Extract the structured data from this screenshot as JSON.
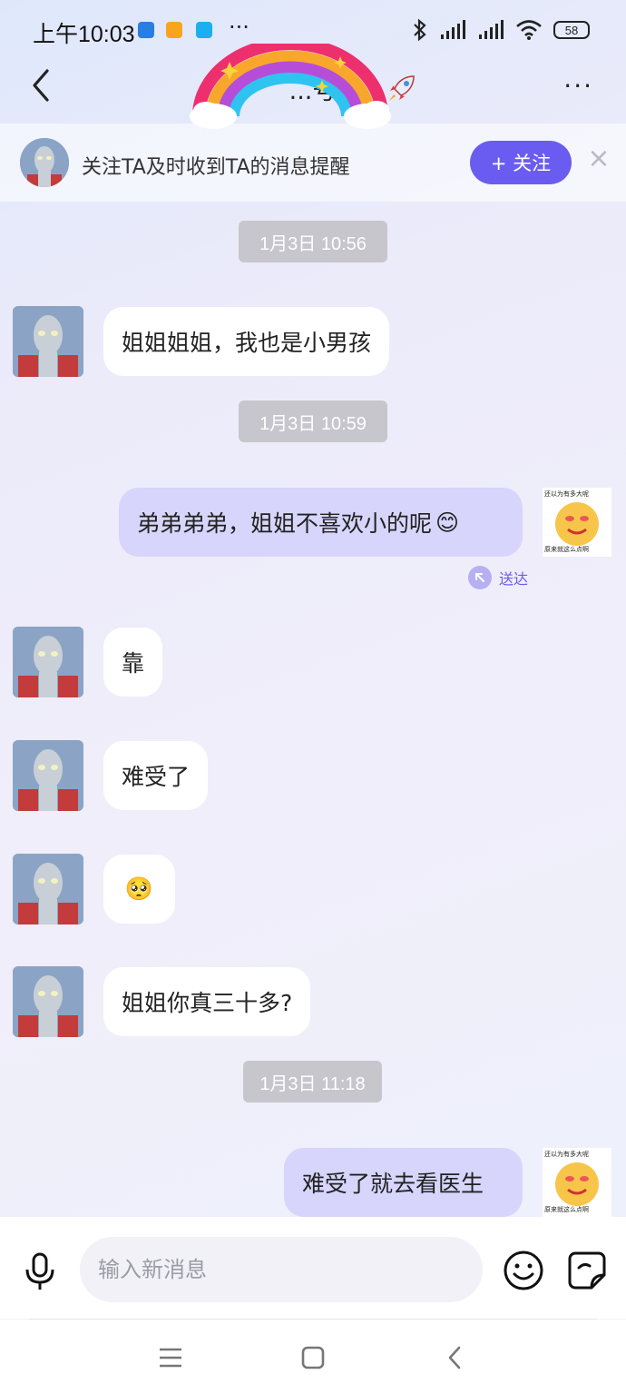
{
  "status_bar": {
    "time": "上午10:03",
    "more": "···",
    "battery": "58"
  },
  "header": {
    "title": "...号",
    "more": "···"
  },
  "follow_banner": {
    "text": "关注TA及时收到TA的消息提醒",
    "button": "+ 关注",
    "close": "×"
  },
  "messages": [
    {
      "type": "timestamp",
      "text": "1月3日 10:56"
    },
    {
      "type": "incoming",
      "text": "姐姐姐姐，我也是小男孩"
    },
    {
      "type": "timestamp",
      "text": "1月3日 10:59"
    },
    {
      "type": "outgoing",
      "text": "弟弟弟弟，姐姐不喜欢小的呢"
    },
    {
      "type": "status",
      "text": "送达"
    },
    {
      "type": "incoming",
      "text": "靠"
    },
    {
      "type": "incoming",
      "text": "难受了"
    },
    {
      "type": "incoming",
      "text": "emoji"
    },
    {
      "type": "incoming",
      "text": "姐姐你真三十多?"
    },
    {
      "type": "timestamp",
      "text": "1月3日 11:18"
    },
    {
      "type": "outgoing",
      "text": "难受了就去看医生"
    }
  ],
  "sticker": {
    "top_text": "还以为有多大呢",
    "bottom_text": "原来就这么点啊"
  },
  "input": {
    "placeholder": "输入新消息"
  },
  "icons": {
    "back": "chevron-left-icon",
    "mic": "microphone-icon",
    "emoji": "smiley-icon",
    "sticker": "sticker-icon",
    "emoji_flushed": "😊",
    "emoji_pleading": "🥺"
  },
  "colors": {
    "accent": "#6a5cf0",
    "outgoing_bubble": "#d7d5fb",
    "timestamp_bg": "#c6c6cc"
  }
}
